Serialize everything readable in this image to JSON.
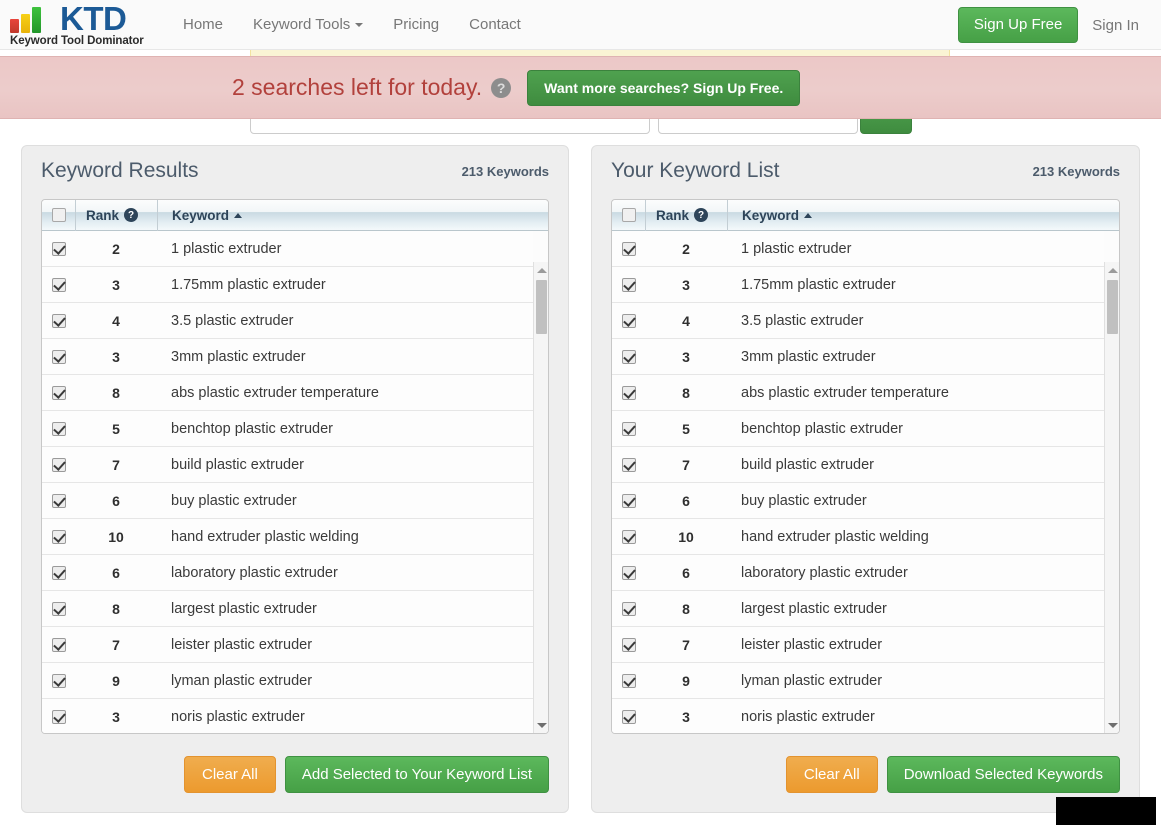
{
  "navbar": {
    "logo_text": "KTD",
    "logo_subtitle": "Keyword Tool Dominator",
    "links": [
      {
        "label": "Home",
        "has_caret": false
      },
      {
        "label": "Keyword Tools",
        "has_caret": true
      },
      {
        "label": "Pricing",
        "has_caret": false
      },
      {
        "label": "Contact",
        "has_caret": false
      }
    ],
    "signup_label": "Sign Up Free",
    "signin_label": "Sign In"
  },
  "banner": {
    "searches_left_text": "2 searches left for today.",
    "help_icon": "question-mark-icon",
    "cta_label": "Want more searches? Sign Up Free.",
    "background_color": "#eccccb",
    "text_color": "#b2413c"
  },
  "panels": {
    "left": {
      "title": "Keyword Results",
      "count_label": "213 Keywords",
      "columns": {
        "rank": "Rank",
        "keyword": "Keyword",
        "rank_help_icon": "question-mark-icon",
        "sort_indicator": "sort-ascending-icon"
      },
      "clear_label": "Clear All",
      "action_label": "Add Selected to Your Keyword List"
    },
    "right": {
      "title": "Your Keyword List",
      "count_label": "213 Keywords",
      "columns": {
        "rank": "Rank",
        "keyword": "Keyword",
        "rank_help_icon": "question-mark-icon",
        "sort_indicator": "sort-ascending-icon"
      },
      "clear_label": "Clear All",
      "action_label": "Download Selected Keywords"
    }
  },
  "rows": [
    {
      "rank": "2",
      "keyword": "1 plastic extruder",
      "checked": true
    },
    {
      "rank": "3",
      "keyword": "1.75mm plastic extruder",
      "checked": true
    },
    {
      "rank": "4",
      "keyword": "3.5 plastic extruder",
      "checked": true
    },
    {
      "rank": "3",
      "keyword": "3mm plastic extruder",
      "checked": true
    },
    {
      "rank": "8",
      "keyword": "abs plastic extruder temperature",
      "checked": true
    },
    {
      "rank": "5",
      "keyword": "benchtop plastic extruder",
      "checked": true
    },
    {
      "rank": "7",
      "keyword": "build plastic extruder",
      "checked": true
    },
    {
      "rank": "6",
      "keyword": "buy plastic extruder",
      "checked": true
    },
    {
      "rank": "10",
      "keyword": "hand extruder plastic welding",
      "checked": true
    },
    {
      "rank": "6",
      "keyword": "laboratory plastic extruder",
      "checked": true
    },
    {
      "rank": "8",
      "keyword": "largest plastic extruder",
      "checked": true
    },
    {
      "rank": "7",
      "keyword": "leister plastic extruder",
      "checked": true
    },
    {
      "rank": "9",
      "keyword": "lyman plastic extruder",
      "checked": true
    },
    {
      "rank": "3",
      "keyword": "noris plastic extruder",
      "checked": true
    }
  ],
  "colors": {
    "brand_blue": "#1c5a96",
    "green": "#5cb85c",
    "orange": "#f0ad4e",
    "banner_pink": "#eccccb",
    "panel_gray": "#eeeeee"
  }
}
